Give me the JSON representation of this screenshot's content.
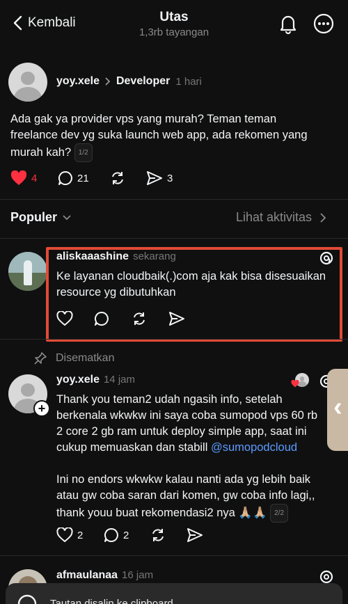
{
  "header": {
    "back_label": "Kembali",
    "title": "Utas",
    "subtitle": "1,3rb tayangan",
    "bell_icon": "bell-icon",
    "more_icon": "more-icon"
  },
  "post": {
    "username": "yoy.xele",
    "topic": "Developer",
    "time": "1 hari",
    "text_lines": [
      "Ada gak ya provider vps yang murah? Teman teman",
      "freelance dev yg suka launch web app, ada rekomen yang",
      "murah kah?"
    ],
    "page_pill": "1/2",
    "likes": "4",
    "replies": "21",
    "shares": "3"
  },
  "sort": {
    "label": "Populer",
    "activity_link": "Lihat aktivitas"
  },
  "replies": [
    {
      "username": "aliskaaashine",
      "time": "sekarang",
      "text_lines": [
        "Ke layanan cloudbaik(.)com aja kak bisa disesuaikan",
        "resource yg dibutuhkan"
      ]
    },
    {
      "pinned_label": "Disematkan",
      "username": "yoy.xele",
      "time": "14 jam",
      "text_lines": [
        "Thank you teman2 udah ngasih info, setelah",
        "berkenala wkwkw ini saya coba sumopod vps 60 rb",
        "2 core 2 gb ram untuk deploy simple app, saat ini",
        "cukup memuaskan dan stabill"
      ],
      "mention": "@sumopodcloud",
      "text2_lines": [
        "Ini no endors wkwkw kalau nanti ada yg lebih baik",
        "atau gw coba saran dari komen, gw coba info lagi,,",
        "thank youu buat rekomendasi2 nya 🙏🏼🙏🏼"
      ],
      "page_pill": "2/2",
      "likes": "2",
      "replies": "2"
    },
    {
      "username": "afmaulanaa",
      "time": "16 jam"
    }
  ],
  "toast": {
    "text": "Tautan disalin ke clipboard"
  },
  "colors": {
    "background": "#101010",
    "like_red": "#ff3040",
    "mention_blue": "#5b9bff",
    "highlight_border": "#e24b36"
  }
}
